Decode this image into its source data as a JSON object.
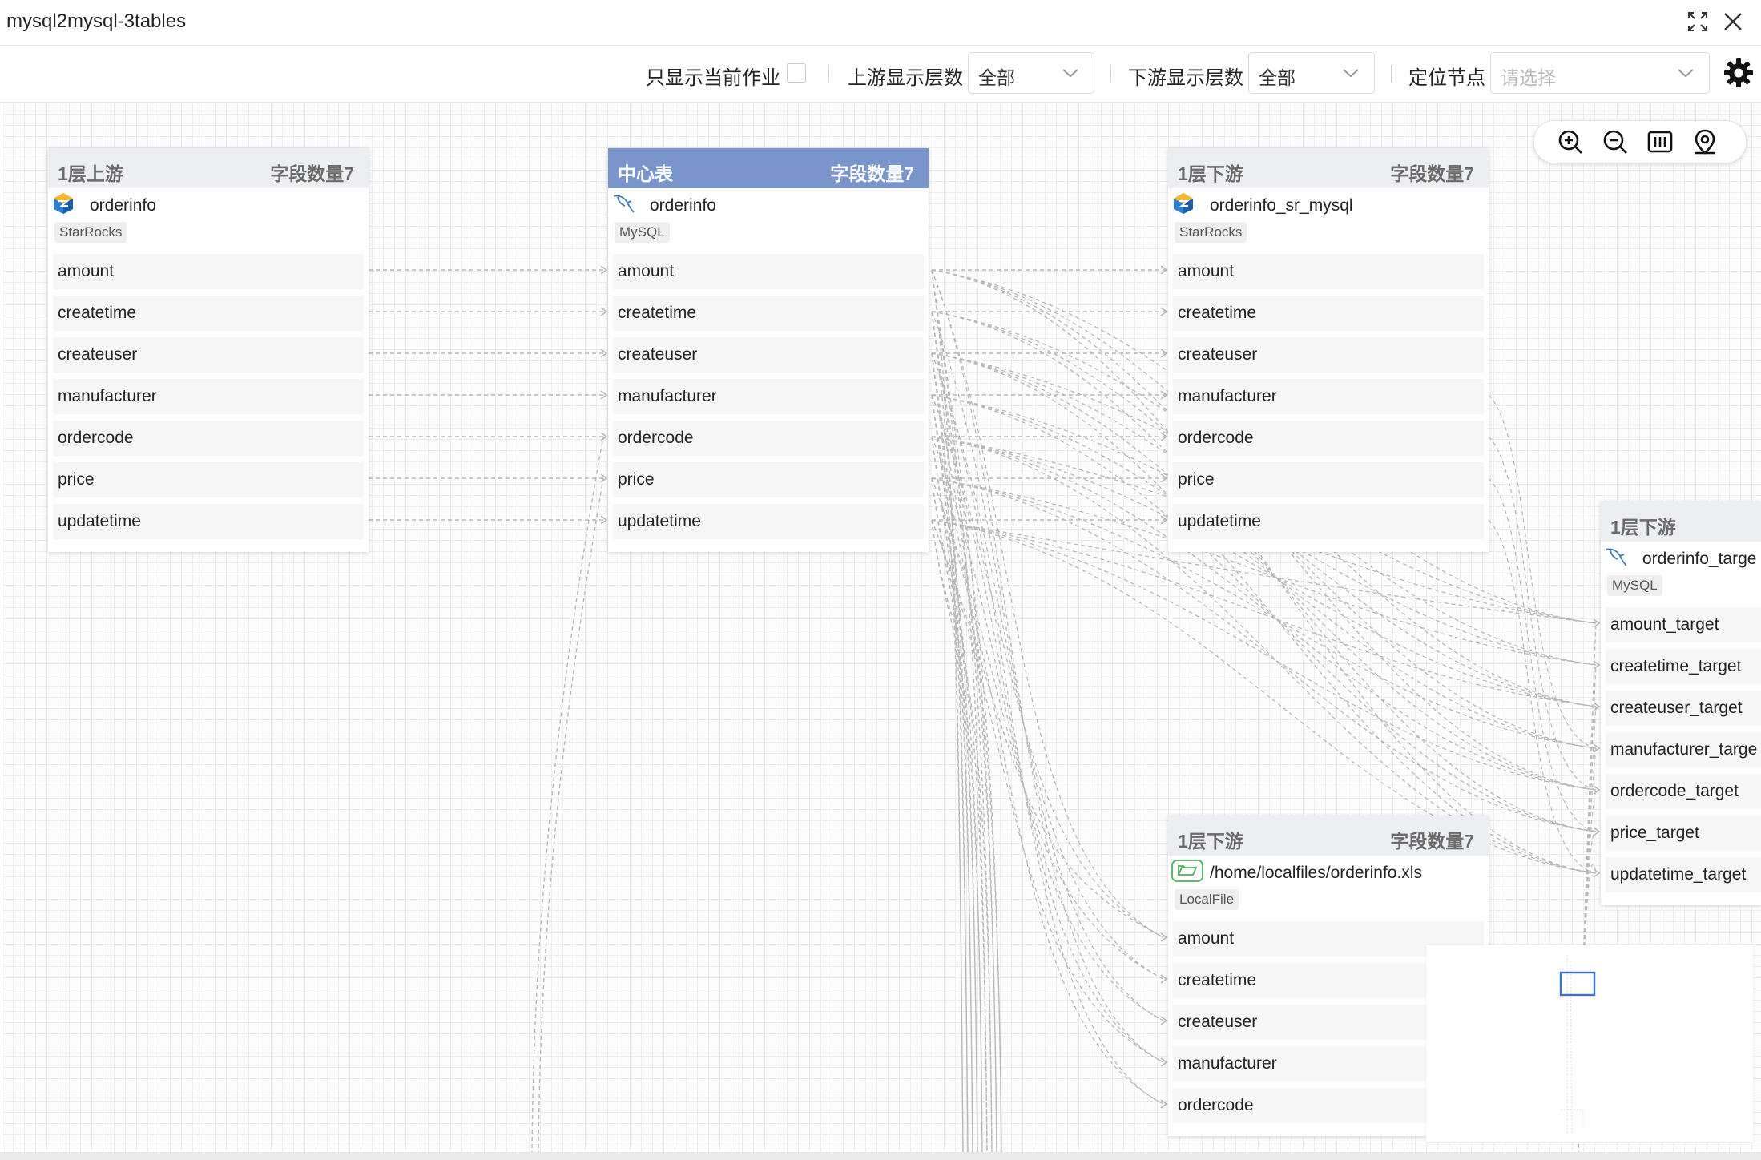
{
  "window": {
    "title": "mysql2mysql-3tables",
    "icons": [
      "fullscreen-icon",
      "close-icon"
    ]
  },
  "toolbar": {
    "only_current_label": "只显示当前作业",
    "only_current_checked": false,
    "upstream_label": "上游显示层数",
    "upstream_value": "全部",
    "downstream_label": "下游显示层数",
    "downstream_value": "全部",
    "locate_label": "定位节点",
    "locate_placeholder": "请选择",
    "settings_icon": "gear-icon"
  },
  "zoom_tools": [
    "zoom-in-icon",
    "zoom-out-icon",
    "fit-view-icon",
    "locate-icon"
  ],
  "nodes": {
    "upstream": {
      "level": "1层上游",
      "count": "字段数量7",
      "name": "orderinfo",
      "type": "StarRocks",
      "fields": [
        "amount",
        "createtime",
        "createuser",
        "manufacturer",
        "ordercode",
        "price",
        "updatetime"
      ]
    },
    "center": {
      "level": "中心表",
      "count": "字段数量7",
      "name": "orderinfo",
      "type": "MySQL",
      "fields": [
        "amount",
        "createtime",
        "createuser",
        "manufacturer",
        "ordercode",
        "price",
        "updatetime"
      ]
    },
    "down_sr": {
      "level": "1层下游",
      "count": "字段数量7",
      "name": "orderinfo_sr_mysql",
      "type": "StarRocks",
      "fields": [
        "amount",
        "createtime",
        "createuser",
        "manufacturer",
        "ordercode",
        "price",
        "updatetime"
      ]
    },
    "down_target": {
      "level": "1层下游",
      "name": "orderinfo_targe",
      "type": "MySQL",
      "fields": [
        "amount_target",
        "createtime_target",
        "createuser_target",
        "manufacturer_targe",
        "ordercode_target",
        "price_target",
        "updatetime_target"
      ]
    },
    "down_file": {
      "level": "1层下游",
      "count": "字段数量7",
      "name": "/home/localfiles/orderinfo.xls",
      "type": "LocalFile",
      "fields": [
        "amount",
        "createtime",
        "createuser",
        "manufacturer",
        "ordercode"
      ]
    }
  },
  "colors": {
    "center_header": "#7a95cc",
    "header": "#eceef1",
    "edge": "#b8b8b8",
    "minimap_viewport": "#3d6fd6"
  }
}
